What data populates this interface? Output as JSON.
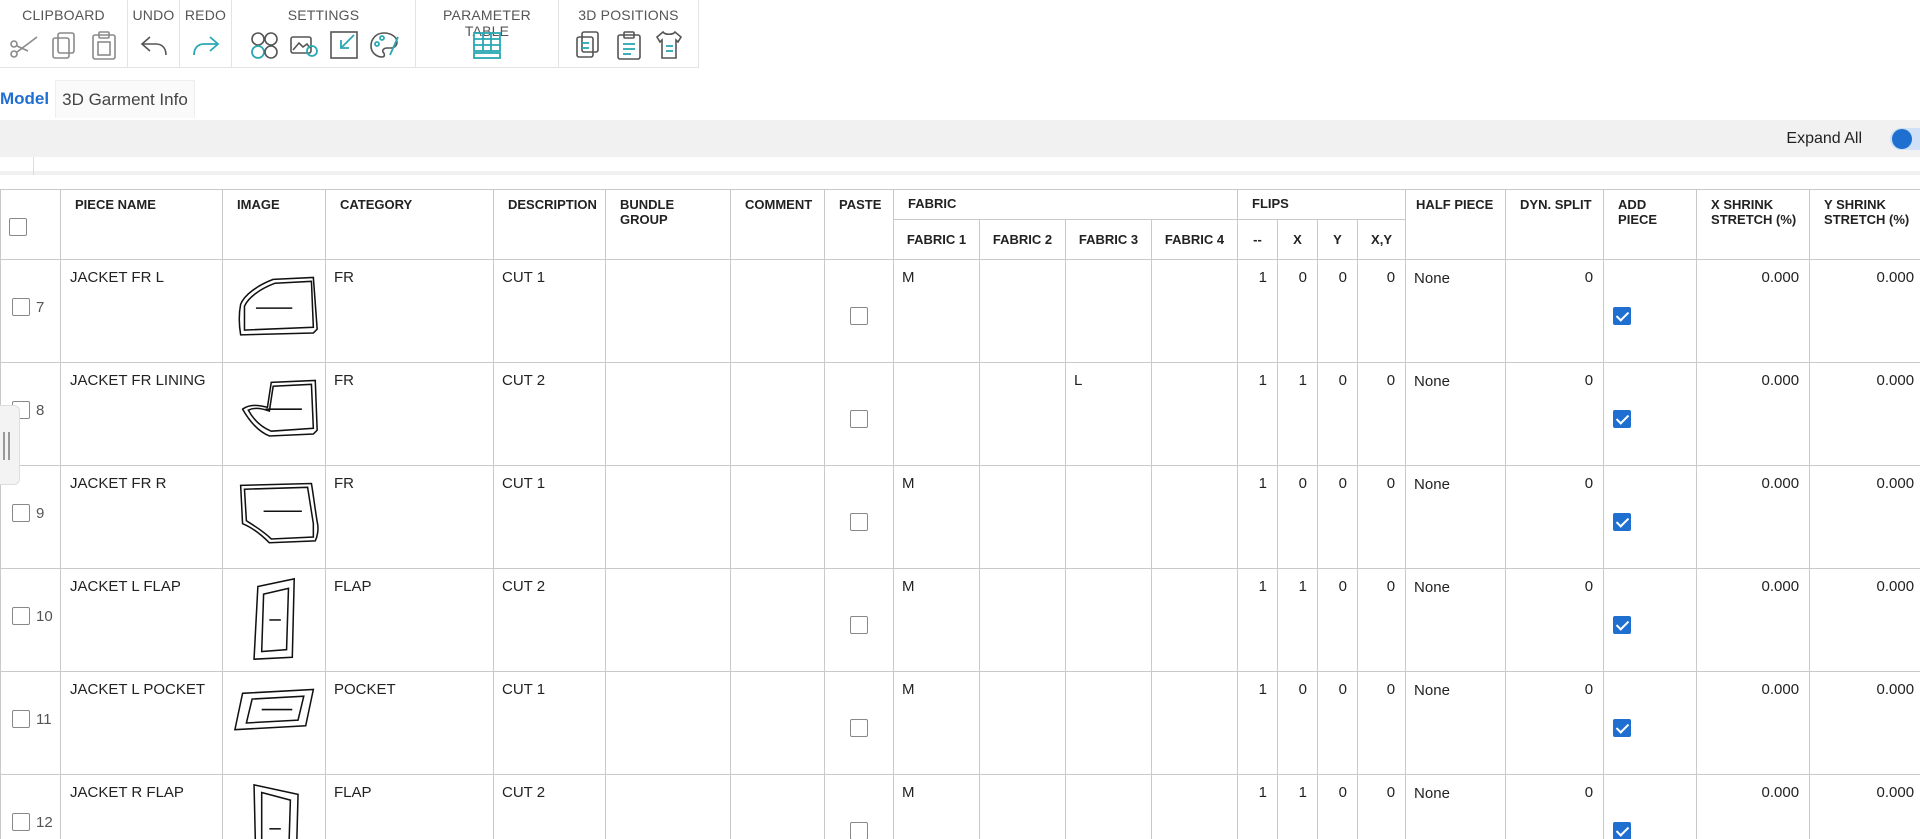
{
  "ribbon": {
    "groups": [
      {
        "id": "clipboard",
        "title": "CLIPBOARD",
        "icons": [
          "scissors-icon",
          "copy-icon",
          "paste-icon"
        ]
      },
      {
        "id": "undo",
        "title": "UNDO",
        "icons": [
          "undo-icon"
        ]
      },
      {
        "id": "redo",
        "title": "REDO",
        "icons": [
          "redo-icon"
        ]
      },
      {
        "id": "settings",
        "title": "SETTINGS",
        "icons": [
          "sizes-icon",
          "image-settings-icon",
          "shrink-icon",
          "palette-icon"
        ]
      },
      {
        "id": "parameter_table",
        "title": "PARAMETER TABLE",
        "icons": [
          "table-ruler-icon"
        ]
      },
      {
        "id": "positions_3d",
        "title": "3D POSITIONS",
        "icons": [
          "copy-position-icon",
          "paste-position-icon",
          "garment-position-icon"
        ]
      }
    ]
  },
  "tabs": [
    {
      "label": "Model",
      "active": true
    },
    {
      "label": "3D Garment Info",
      "active": false
    }
  ],
  "toolbar": {
    "expand_all_label": "Expand All",
    "expand_all_on": true
  },
  "accent_color": "#1f6fd1",
  "table": {
    "headers": {
      "piece_name": "PIECE NAME",
      "image": "IMAGE",
      "category": "CATEGORY",
      "description": "DESCRIPTION",
      "bundle_group": "BUNDLE GROUP",
      "comment": "COMMENT",
      "paste": "PASTE",
      "fabric": "FABRIC",
      "fabric1": "FABRIC 1",
      "fabric2": "FABRIC 2",
      "fabric3": "FABRIC 3",
      "fabric4": "FABRIC 4",
      "flips": "FLIPS",
      "flip_none": "--",
      "flip_x": "X",
      "flip_y": "Y",
      "flip_xy": "X,Y",
      "half_piece": "HALF PIECE",
      "dyn_split": "DYN. SPLIT",
      "add_piece": "ADD PIECE",
      "x_shrink": "X SHRINK STRETCH (%)",
      "y_shrink": "Y SHRINK STRETCH (%)"
    },
    "rows": [
      {
        "num": "7",
        "name": "JACKET FR L",
        "shape": "front-left",
        "category": "FR",
        "description": "CUT 1",
        "bundle": "",
        "comment": "",
        "paste": false,
        "fabric1": "M",
        "fabric2": "",
        "fabric3": "",
        "fabric4": "",
        "flip_none": "1",
        "flip_x": "0",
        "flip_y": "0",
        "flip_xy": "0",
        "half": "None",
        "dyn": "0",
        "add": true,
        "xs": "0.000",
        "ys": "0.000"
      },
      {
        "num": "8",
        "name": "JACKET FR LINING",
        "shape": "front-lining",
        "category": "FR",
        "description": "CUT 2",
        "bundle": "",
        "comment": "",
        "paste": false,
        "fabric1": "",
        "fabric2": "",
        "fabric3": "L",
        "fabric4": "",
        "flip_none": "1",
        "flip_x": "1",
        "flip_y": "0",
        "flip_xy": "0",
        "half": "None",
        "dyn": "0",
        "add": true,
        "xs": "0.000",
        "ys": "0.000"
      },
      {
        "num": "9",
        "name": "JACKET FR R",
        "shape": "front-right",
        "category": "FR",
        "description": "CUT 1",
        "bundle": "",
        "comment": "",
        "paste": false,
        "fabric1": "M",
        "fabric2": "",
        "fabric3": "",
        "fabric4": "",
        "flip_none": "1",
        "flip_x": "0",
        "flip_y": "0",
        "flip_xy": "0",
        "half": "None",
        "dyn": "0",
        "add": true,
        "xs": "0.000",
        "ys": "0.000"
      },
      {
        "num": "10",
        "name": "JACKET L FLAP",
        "shape": "flap",
        "category": "FLAP",
        "description": "CUT 2",
        "bundle": "",
        "comment": "",
        "paste": false,
        "fabric1": "M",
        "fabric2": "",
        "fabric3": "",
        "fabric4": "",
        "flip_none": "1",
        "flip_x": "1",
        "flip_y": "0",
        "flip_xy": "0",
        "half": "None",
        "dyn": "0",
        "add": true,
        "xs": "0.000",
        "ys": "0.000"
      },
      {
        "num": "11",
        "name": "JACKET L POCKET",
        "shape": "pocket",
        "category": "POCKET",
        "description": "CUT 1",
        "bundle": "",
        "comment": "",
        "paste": false,
        "fabric1": "M",
        "fabric2": "",
        "fabric3": "",
        "fabric4": "",
        "flip_none": "1",
        "flip_x": "0",
        "flip_y": "0",
        "flip_xy": "0",
        "half": "None",
        "dyn": "0",
        "add": true,
        "xs": "0.000",
        "ys": "0.000"
      },
      {
        "num": "12",
        "name": "JACKET R FLAP",
        "shape": "flap-r",
        "category": "FLAP",
        "description": "CUT 2",
        "bundle": "",
        "comment": "",
        "paste": false,
        "fabric1": "M",
        "fabric2": "",
        "fabric3": "",
        "fabric4": "",
        "flip_none": "1",
        "flip_x": "1",
        "flip_y": "0",
        "flip_xy": "0",
        "half": "None",
        "dyn": "0",
        "add": true,
        "xs": "0.000",
        "ys": "0.000"
      }
    ]
  }
}
